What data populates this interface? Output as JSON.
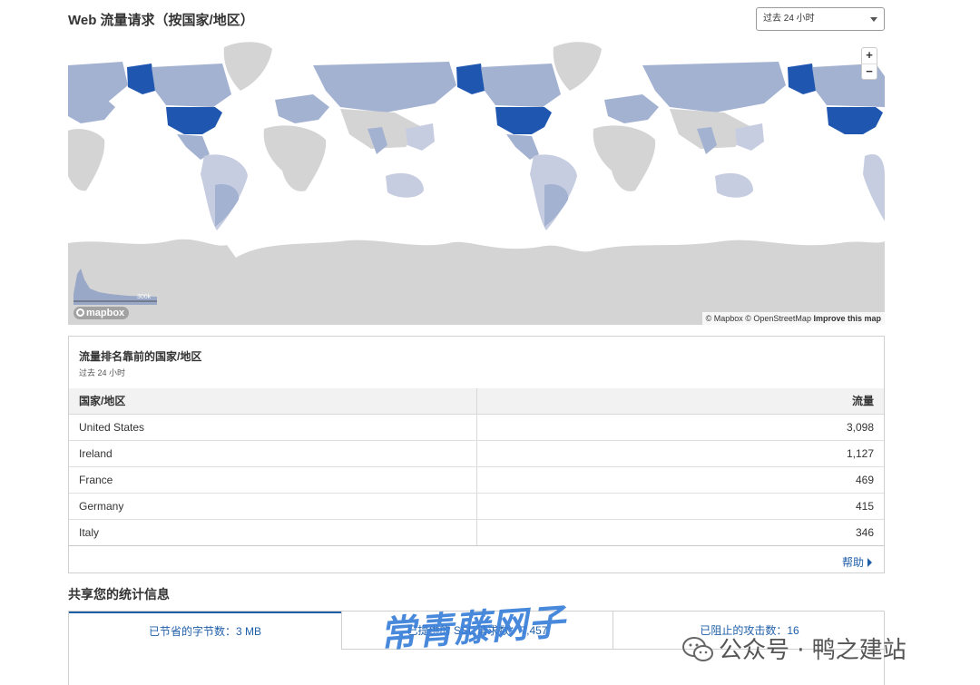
{
  "header": {
    "title": "Web 流量请求（按国家/地区）",
    "range_select": "过去 24 小时"
  },
  "map": {
    "zoom_in": "+",
    "zoom_out": "−",
    "logo": "mapbox",
    "histogram_max_label": "300k",
    "attribution": "© Mapbox © OpenStreetMap",
    "improve_link": "Improve this map",
    "colors": {
      "land_no_data": "#d4d4d4",
      "land_low": "#a4b2d2",
      "land_high": "#1f56b0"
    }
  },
  "top_countries": {
    "title": "流量排名靠前的国家/地区",
    "subtitle": "过去 24 小时",
    "columns": [
      "国家/地区",
      "流量"
    ],
    "rows": [
      {
        "country": "United States",
        "traffic": "3,098"
      },
      {
        "country": "Ireland",
        "traffic": "1,127"
      },
      {
        "country": "France",
        "traffic": "469"
      },
      {
        "country": "Germany",
        "traffic": "415"
      },
      {
        "country": "Italy",
        "traffic": "346"
      }
    ],
    "help_link": "帮助"
  },
  "share_stats": {
    "title": "共享您的统计信息",
    "tabs": [
      {
        "label": "已节省的字节数：3 MB"
      },
      {
        "label": "已提供的 SSL 请求数：7,457"
      },
      {
        "label": "已阻止的攻击数：16"
      }
    ]
  },
  "overlay": {
    "watermark": "常青藤网子",
    "wechat": "公众号 · 鸭之建站"
  }
}
